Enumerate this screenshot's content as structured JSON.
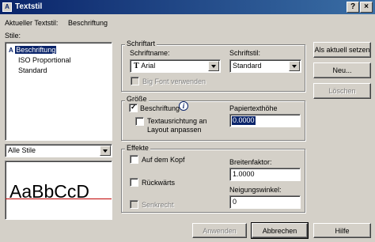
{
  "window": {
    "title": "Textstil",
    "minimize_glyph": "?",
    "close_glyph": "×"
  },
  "current_style": {
    "label": "Aktueller Textstil:",
    "value": "Beschriftung"
  },
  "styles": {
    "label": "Stile:",
    "items": [
      {
        "label": "Beschriftung",
        "annotative_icon": "A",
        "selected": true
      },
      {
        "label": "ISO Proportional",
        "selected": false
      },
      {
        "label": "Standard",
        "selected": false
      }
    ],
    "filter_value": "Alle Stile",
    "preview_text": "AaBbCcD"
  },
  "font": {
    "group_title": "Schriftart",
    "name_label": "Schriftname:",
    "name_value": "Arial",
    "name_icon_glyph": "T",
    "style_label": "Schriftstil:",
    "style_value": "Standard",
    "bigfont_label": "Big Font verwenden"
  },
  "size": {
    "group_title": "Größe",
    "annotative_label": "Beschriftung",
    "info_glyph": "i",
    "orientation_label_line1": "Textausrichtung an",
    "orientation_label_line2": "Layout anpassen",
    "paper_height_label": "Papiertexthöhe",
    "paper_height_value": "0.0000"
  },
  "effects": {
    "group_title": "Effekte",
    "upside_down_label": "Auf dem Kopf",
    "backwards_label": "Rückwärts",
    "vertical_label": "Senkrecht",
    "width_factor_label": "Breitenfaktor:",
    "width_factor_value": "1.0000",
    "oblique_label": "Neigungswinkel:",
    "oblique_value": "0"
  },
  "buttons": {
    "set_current": "Als aktuell setzen",
    "new": "Neu...",
    "delete": "Löschen",
    "apply": "Anwenden",
    "cancel": "Abbrechen",
    "help": "Hilfe"
  },
  "colors": {
    "titlebar": "#0a246a",
    "selection": "#0a246a",
    "preview_baseline": "#c00000"
  }
}
